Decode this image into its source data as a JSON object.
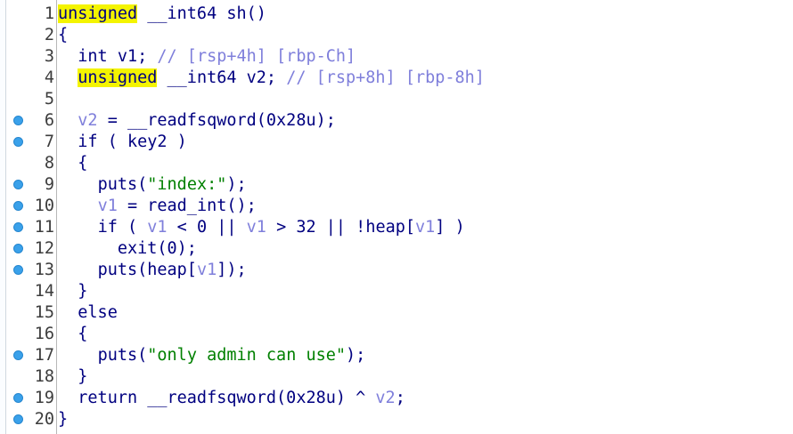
{
  "editor": {
    "lines": [
      {
        "num": "1",
        "bp": false,
        "indent": "",
        "parts": [
          {
            "t": "unsigned",
            "c": "kw-hl"
          },
          {
            "t": " __int64 sh()",
            "c": ""
          }
        ]
      },
      {
        "num": "2",
        "bp": false,
        "indent": "",
        "parts": [
          {
            "t": "{",
            "c": ""
          }
        ]
      },
      {
        "num": "3",
        "bp": false,
        "indent": "  ",
        "parts": [
          {
            "t": "int v1; ",
            "c": ""
          },
          {
            "t": "// [rsp+4h] [rbp-Ch]",
            "c": "cmt"
          }
        ]
      },
      {
        "num": "4",
        "bp": false,
        "indent": "  ",
        "parts": [
          {
            "t": "unsigned",
            "c": "kw-hl"
          },
          {
            "t": " __int64 v2; ",
            "c": ""
          },
          {
            "t": "// [rsp+8h] [rbp-8h]",
            "c": "cmt"
          }
        ]
      },
      {
        "num": "5",
        "bp": false,
        "indent": "",
        "parts": []
      },
      {
        "num": "6",
        "bp": true,
        "indent": "  ",
        "parts": [
          {
            "t": "v2",
            "c": "var"
          },
          {
            "t": " = __readfsqword(0x28u);",
            "c": ""
          }
        ]
      },
      {
        "num": "7",
        "bp": true,
        "indent": "  ",
        "parts": [
          {
            "t": "if ( key2 )",
            "c": ""
          }
        ]
      },
      {
        "num": "8",
        "bp": false,
        "indent": "  ",
        "parts": [
          {
            "t": "{",
            "c": ""
          }
        ]
      },
      {
        "num": "9",
        "bp": true,
        "indent": "    ",
        "parts": [
          {
            "t": "puts(",
            "c": ""
          },
          {
            "t": "\"index:\"",
            "c": "str"
          },
          {
            "t": ");",
            "c": ""
          }
        ]
      },
      {
        "num": "10",
        "bp": true,
        "indent": "    ",
        "parts": [
          {
            "t": "v1",
            "c": "var"
          },
          {
            "t": " = read_int();",
            "c": ""
          }
        ]
      },
      {
        "num": "11",
        "bp": true,
        "indent": "    ",
        "parts": [
          {
            "t": "if ( ",
            "c": ""
          },
          {
            "t": "v1",
            "c": "var"
          },
          {
            "t": " < 0 || ",
            "c": ""
          },
          {
            "t": "v1",
            "c": "var"
          },
          {
            "t": " > 32 || !heap[",
            "c": ""
          },
          {
            "t": "v1",
            "c": "var"
          },
          {
            "t": "] )",
            "c": ""
          }
        ]
      },
      {
        "num": "12",
        "bp": true,
        "indent": "      ",
        "parts": [
          {
            "t": "exit(0);",
            "c": ""
          }
        ]
      },
      {
        "num": "13",
        "bp": true,
        "indent": "    ",
        "parts": [
          {
            "t": "puts(heap[",
            "c": ""
          },
          {
            "t": "v1",
            "c": "var"
          },
          {
            "t": "]);",
            "c": ""
          }
        ]
      },
      {
        "num": "14",
        "bp": false,
        "indent": "  ",
        "parts": [
          {
            "t": "}",
            "c": ""
          }
        ]
      },
      {
        "num": "15",
        "bp": false,
        "indent": "  ",
        "parts": [
          {
            "t": "else",
            "c": ""
          }
        ]
      },
      {
        "num": "16",
        "bp": false,
        "indent": "  ",
        "parts": [
          {
            "t": "{",
            "c": ""
          }
        ]
      },
      {
        "num": "17",
        "bp": true,
        "indent": "    ",
        "parts": [
          {
            "t": "puts(",
            "c": ""
          },
          {
            "t": "\"only admin can use\"",
            "c": "str"
          },
          {
            "t": ");",
            "c": ""
          }
        ]
      },
      {
        "num": "18",
        "bp": false,
        "indent": "  ",
        "parts": [
          {
            "t": "}",
            "c": ""
          }
        ]
      },
      {
        "num": "19",
        "bp": true,
        "indent": "  ",
        "parts": [
          {
            "t": "return __readfsqword(0x28u) ^ ",
            "c": ""
          },
          {
            "t": "v2",
            "c": "var"
          },
          {
            "t": ";",
            "c": ""
          }
        ]
      },
      {
        "num": "20",
        "bp": true,
        "indent": "",
        "parts": [
          {
            "t": "}",
            "c": ""
          }
        ]
      }
    ]
  }
}
